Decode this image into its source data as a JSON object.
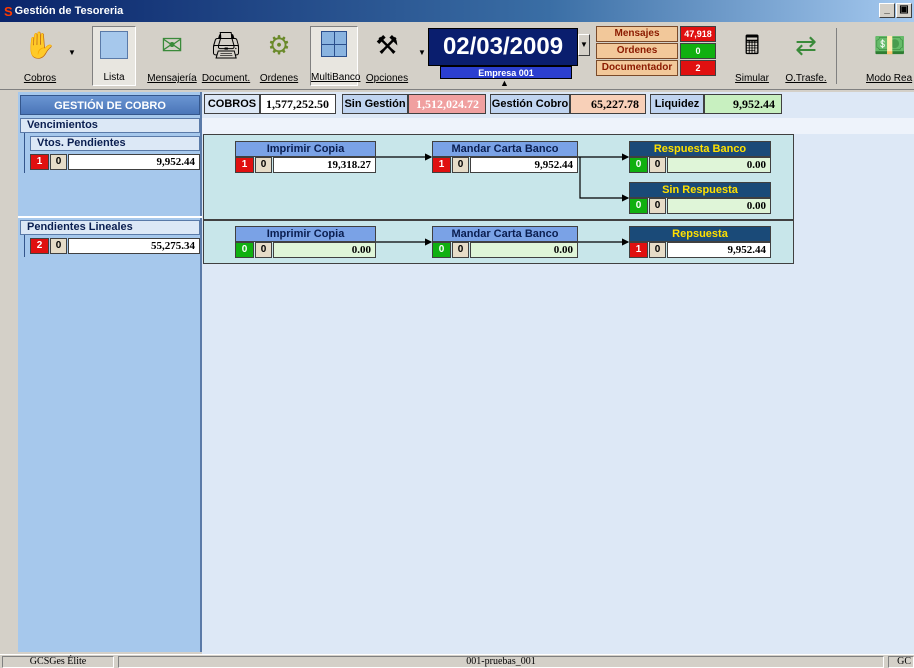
{
  "window": {
    "title": "Gestión de Tesoreria",
    "controls": [
      "_",
      "▣"
    ]
  },
  "toolbar": {
    "buttons": [
      {
        "label": "Cobros",
        "icon": "hand-coins-icon"
      },
      {
        "label": "Lista",
        "icon": "list-view-icon"
      },
      {
        "label": "Mensajería",
        "icon": "envelope-arrow-icon"
      },
      {
        "label": "Document.",
        "icon": "documents-stack-icon"
      },
      {
        "label": "Ordenes",
        "icon": "gears-icon"
      },
      {
        "label": "MultiBanco",
        "icon": "multi-bank-grid-icon"
      },
      {
        "label": "Opciones",
        "icon": "tools-hammer-icon"
      },
      {
        "label": "Simular",
        "icon": "calculator-clock-icon"
      },
      {
        "label": "O.Trasfe.",
        "icon": "transfer-icon"
      },
      {
        "label": "Modo Rea",
        "icon": "money-icon"
      }
    ],
    "date": "02/03/2009",
    "empresa": "Empresa 001",
    "counters": [
      {
        "label": "Mensajes",
        "value": "47,918",
        "color": "#e01010"
      },
      {
        "label": "Ordenes",
        "value": "0",
        "color": "#10b010"
      },
      {
        "label": "Documentador",
        "value": "2",
        "color": "#e01010"
      }
    ]
  },
  "left_panel": {
    "title": "GESTIÓN DE COBRO",
    "vencimientos": "Vencimientos",
    "vtos_pendientes": {
      "label": "Vtos. Pendientes",
      "count": "1",
      "zero": "0",
      "amount": "9,952.44"
    },
    "pendientes_lineales": {
      "label": "Pendientes Lineales",
      "count": "2",
      "zero": "0",
      "amount": "55,275.34"
    }
  },
  "summary": {
    "cobros_label": "COBROS",
    "cobros_value": "1,577,252.50",
    "sin_gestion_label": "Sin Gestión",
    "sin_gestion_value": "1,512,024.72",
    "gestion_cobro_label": "Gestión Cobro",
    "gestion_cobro_value": "65,227.78",
    "liquidez_label": "Liquidez",
    "liquidez_value": "9,952.44"
  },
  "flow1": {
    "imprimir": {
      "title": "Imprimir Copia",
      "count": "1",
      "zero": "0",
      "amount": "19,318.27"
    },
    "mandar": {
      "title": "Mandar Carta Banco",
      "count": "1",
      "zero": "0",
      "amount": "9,952.44"
    },
    "respuesta": {
      "title": "Respuesta Banco",
      "count": "0",
      "zero": "0",
      "amount": "0.00"
    },
    "sin_respuesta": {
      "title": "Sin Respuesta",
      "count": "0",
      "zero": "0",
      "amount": "0.00"
    }
  },
  "flow2": {
    "imprimir": {
      "title": "Imprimir Copia",
      "count": "0",
      "zero": "0",
      "amount": "0.00"
    },
    "mandar": {
      "title": "Mandar Carta Banco",
      "count": "0",
      "zero": "0",
      "amount": "0.00"
    },
    "respuesta": {
      "title": "Repsuesta",
      "count": "1",
      "zero": "0",
      "amount": "9,952.44"
    }
  },
  "statusbar": {
    "app": "GCSGes Élite",
    "db": "001-pruebas_001",
    "right": "GC"
  },
  "colors": {
    "red": "#e01010",
    "green": "#10b010",
    "sin_gestion_bg": "#f0a0a0",
    "gestion_cobro_bg": "#f8d0b8",
    "liquidez_bg": "#c8f0c0"
  }
}
